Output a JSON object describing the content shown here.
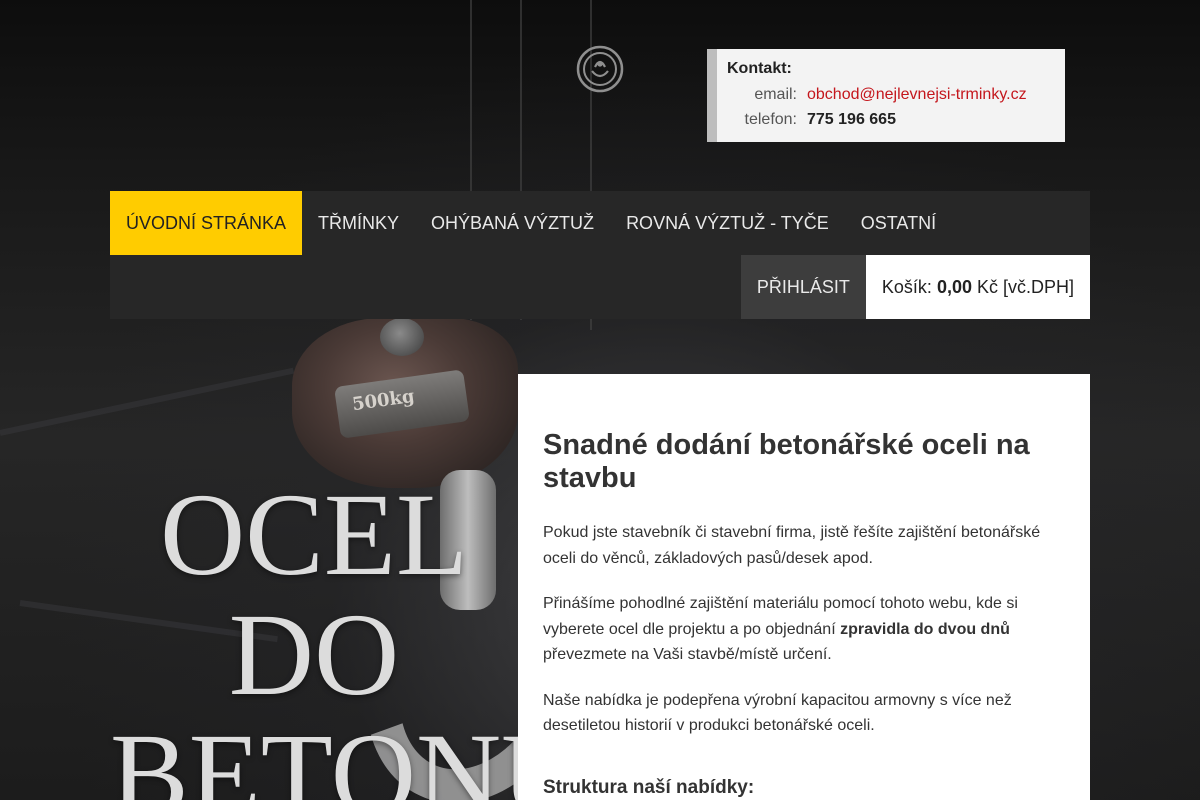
{
  "contact": {
    "title": "Kontakt:",
    "email_label": "email:",
    "email_value": "obchod@nejlevnejsi-trminky.cz",
    "phone_label": "telefon:",
    "phone_value": "775 196 665"
  },
  "nav": {
    "items": [
      {
        "label": "Úvodní stránka"
      },
      {
        "label": "Třmínky"
      },
      {
        "label": "Ohýbaná výztuž"
      },
      {
        "label": "Rovná výztuž - tyče"
      },
      {
        "label": "Ostatní"
      }
    ],
    "login_label": "Přihlásit",
    "cart_prefix": "Košík: ",
    "cart_amount": "0,00",
    "cart_suffix": " Kč [vč.DPH]"
  },
  "hero": {
    "line1": "OCEL",
    "line2": "DO",
    "line3": "BETONU"
  },
  "main": {
    "heading": "Snadné dodání betonářské oceli na stavbu",
    "para1": "Pokud jste stavebník či stavební firma, jistě řešíte zajištění betonářské oceli do věnců, základových pasů/desek apod.",
    "para2_before": "Přinášíme pohodlné zajištění materiálu pomocí tohoto webu, kde si vyberete ocel dle projektu a po objednání ",
    "para2_bold": "zpravidla do dvou dnů",
    "para2_after": " převezmete na Vaši stavbě/místě určení.",
    "para3": "Naše nabídka je podepřena výrobní kapacitou armovny s více než desetiletou historií v produkci betonářské oceli.",
    "subheading": "Struktura naší nabídky:"
  },
  "decor": {
    "hook_plate_text": "500kg"
  },
  "colors": {
    "accent": "#ffcc00",
    "nav_bg": "#272727",
    "link": "#c4161c"
  }
}
